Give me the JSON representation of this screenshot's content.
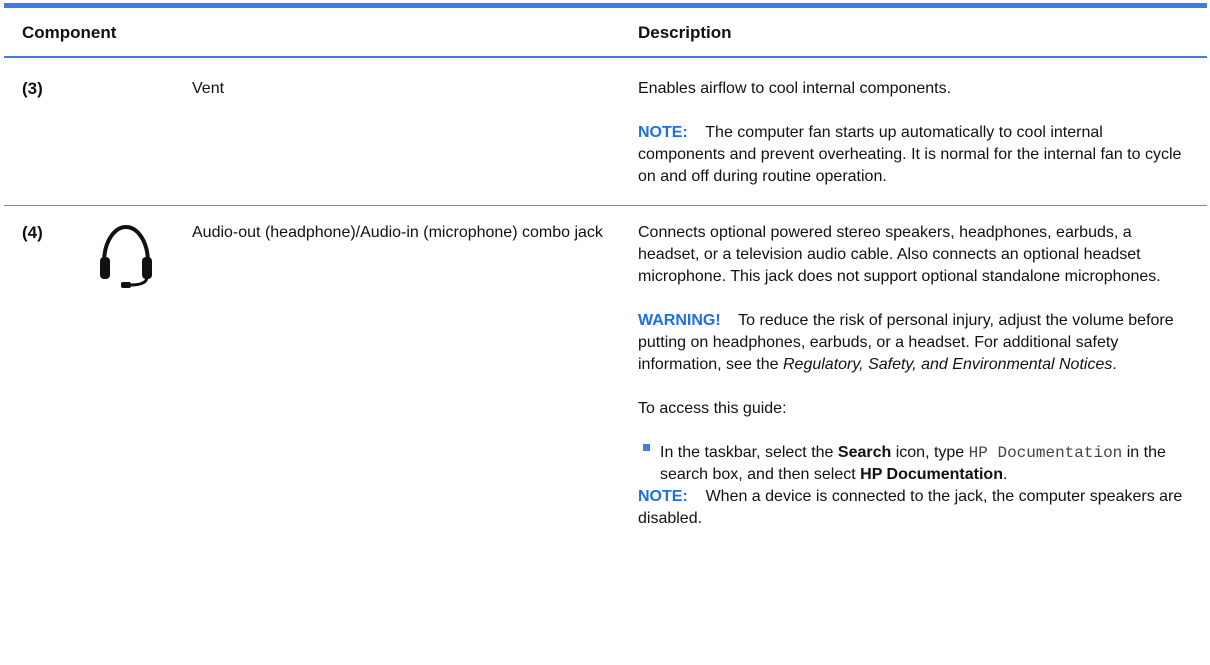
{
  "table": {
    "header": {
      "component": "Component",
      "description": "Description"
    },
    "rows": [
      {
        "number": "(3)",
        "name": "Vent",
        "description": "Enables airflow to cool internal components.",
        "note_label": "NOTE:",
        "note_text": "The computer fan starts up automatically to cool internal components and prevent overheating. It is normal for the internal fan to cycle on and off during routine operation."
      },
      {
        "number": "(4)",
        "icon": "headphone-icon",
        "name": "Audio-out (headphone)/Audio-in (microphone) combo jack",
        "description": "Connects optional powered stereo speakers, headphones, earbuds, a headset, or a television audio cable. Also connects an optional headset microphone. This jack does not support optional standalone microphones.",
        "warning_label": "WARNING!",
        "warning_text": "To reduce the risk of personal injury, adjust the volume before putting on headphones, earbuds, or a headset. For additional safety information, see the",
        "warning_italic": "Regulatory, Safety, and Environmental Notices",
        "warning_end": ".",
        "access_text": "To access this guide:",
        "bullet": {
          "part1": "In the taskbar, select the",
          "bold1": "Search",
          "part2": "icon, type",
          "code": "HP Documentation",
          "part3": "in the search box, and then select",
          "bold2": "HP Documentation",
          "part4": "."
        },
        "note_label": "NOTE:",
        "note_text": "When a device is connected to the jack, the computer speakers are disabled."
      }
    ]
  },
  "colors": {
    "accent": "#3d7ee0",
    "label": "#1f6fe0"
  }
}
